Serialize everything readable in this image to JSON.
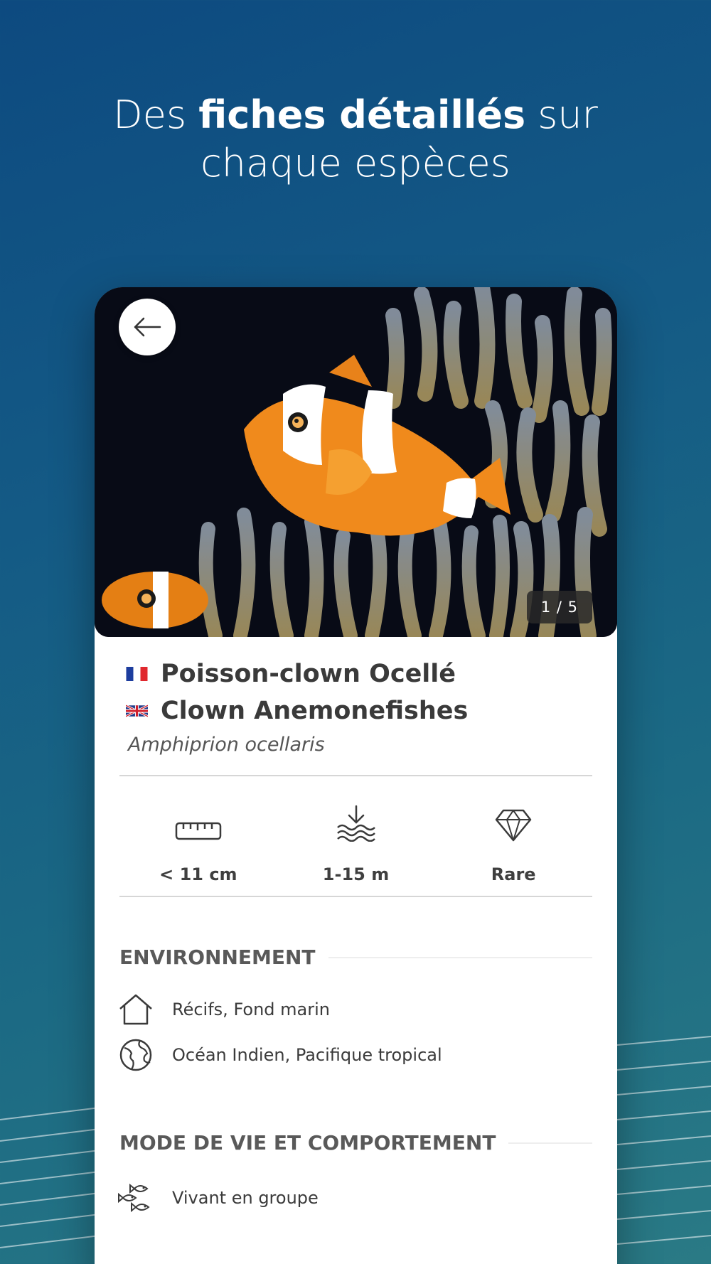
{
  "headline": {
    "part1": "Des ",
    "bold": "fiches détaillés",
    "part2": " sur",
    "line2": "chaque espèces"
  },
  "card": {
    "back_icon": "arrow-left-icon",
    "photo_counter": "1 / 5",
    "names": {
      "fr": "Poisson-clown Ocellé",
      "en": "Clown Anemonefishes",
      "latin": "Amphiprion ocellaris"
    },
    "stats": [
      {
        "icon": "ruler-icon",
        "value": "< 11 cm"
      },
      {
        "icon": "depth-icon",
        "value": "1-15 m"
      },
      {
        "icon": "diamond-icon",
        "value": "Rare"
      }
    ],
    "environment": {
      "title": "ENVIRONNEMENT",
      "items": [
        {
          "icon": "house-icon",
          "text": "Récifs, Fond marin"
        },
        {
          "icon": "globe-icon",
          "text": "Océan Indien, Pacifique tropical"
        }
      ]
    },
    "behaviour": {
      "title": "MODE DE VIE ET COMPORTEMENT",
      "items": [
        {
          "icon": "fish-group-icon",
          "text": "Vivant en groupe"
        }
      ]
    }
  },
  "colors": {
    "background_top": "#0d4a80",
    "background_bottom": "#2a7a85",
    "clownfish_orange": "#f08a1c"
  }
}
